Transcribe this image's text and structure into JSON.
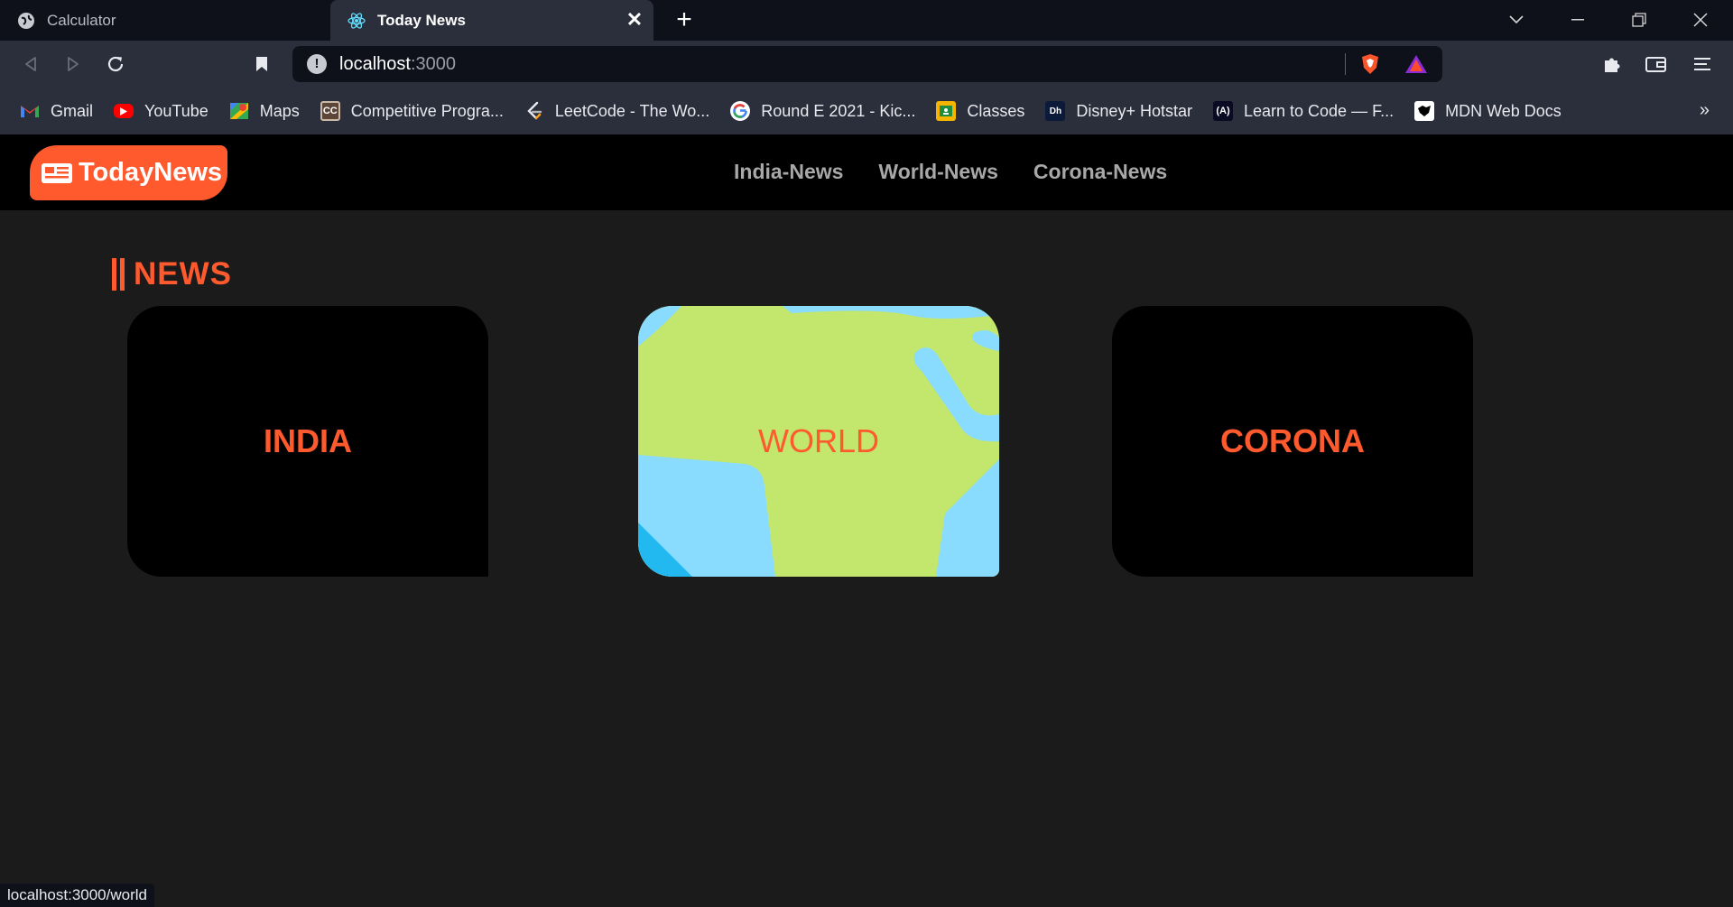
{
  "browser": {
    "tabs": [
      {
        "title": "Calculator",
        "icon": "globe-icon",
        "active": false
      },
      {
        "title": "Today News",
        "icon": "react-icon",
        "active": true
      }
    ],
    "url": {
      "host": "localhost",
      "port": ":3000"
    },
    "bookmarks": [
      {
        "label": "Gmail",
        "icon": "gmail-icon"
      },
      {
        "label": "YouTube",
        "icon": "youtube-icon"
      },
      {
        "label": "Maps",
        "icon": "maps-icon"
      },
      {
        "label": "Competitive Progra...",
        "icon": "codechef-icon"
      },
      {
        "label": "LeetCode - The Wo...",
        "icon": "leetcode-icon"
      },
      {
        "label": "Round E 2021 - Kic...",
        "icon": "google-icon"
      },
      {
        "label": "Classes",
        "icon": "classroom-icon"
      },
      {
        "label": "Disney+ Hotstar",
        "icon": "hotstar-icon"
      },
      {
        "label": "Learn to Code — F...",
        "icon": "freecodecamp-icon"
      },
      {
        "label": "MDN Web Docs",
        "icon": "mdn-icon"
      }
    ],
    "bookmarks_more": "»",
    "status_url": "localhost:3000/world"
  },
  "app": {
    "logo_text": "TodayNews",
    "nav": [
      "India-News",
      "World-News",
      "Corona-News"
    ],
    "section_title": "NEWS",
    "cards": [
      {
        "label": "INDIA"
      },
      {
        "label": "WORLD"
      },
      {
        "label": "CORONA"
      }
    ]
  },
  "colors": {
    "accent": "#ff5a2e",
    "page_bg": "#1b1b1b",
    "header_bg": "#000000",
    "map_land": "#c3e66d",
    "map_water": "#8adcfe"
  }
}
